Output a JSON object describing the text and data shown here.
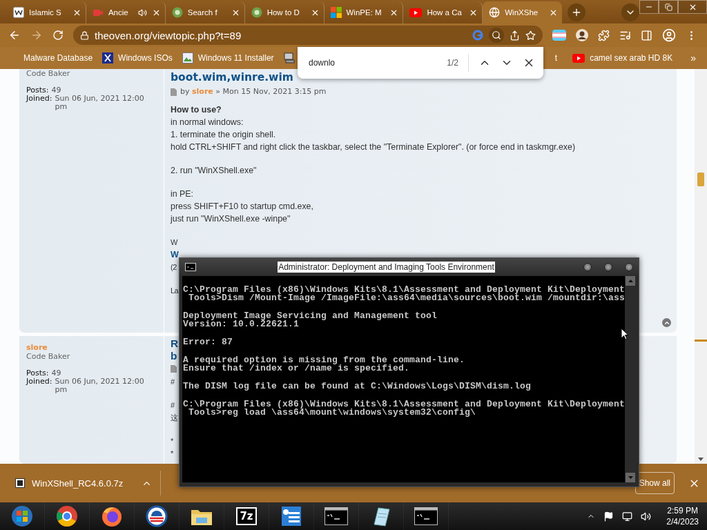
{
  "browser": {
    "tabs": [
      {
        "title": "Islamic S",
        "kind": "wiki",
        "selected": false,
        "audio": false
      },
      {
        "title": "Ancie",
        "kind": "video",
        "selected": false,
        "audio": true
      },
      {
        "title": "Search f",
        "kind": "site",
        "selected": false,
        "audio": false
      },
      {
        "title": "How to D",
        "kind": "site",
        "selected": false,
        "audio": false
      },
      {
        "title": "WinPE: M",
        "kind": "windows",
        "selected": false,
        "audio": false
      },
      {
        "title": "How a Ca",
        "kind": "youtube",
        "selected": false,
        "audio": false
      },
      {
        "title": "WinXShe",
        "kind": "globe",
        "selected": true,
        "audio": false
      }
    ],
    "address": "theoven.org/viewtopic.php?t=89",
    "bookmarks": [
      {
        "label": "Malware Database",
        "kind": "plain"
      },
      {
        "label": "Windows ISOs",
        "kind": "x"
      },
      {
        "label": "Windows 11 Installer",
        "kind": "image"
      },
      {
        "kind": "computer"
      }
    ],
    "bookmarks_right": [
      {
        "label": "t",
        "kind": "plain"
      },
      {
        "label": "camel sex arab HD 8K",
        "kind": "youtube"
      }
    ],
    "more_bookmarks": "»",
    "find_bar": {
      "query": "downlo",
      "count": "1/2"
    }
  },
  "posts": [
    {
      "rank": "Code Baker",
      "posts_label": "Posts:",
      "posts": "49",
      "joined_label": "Joined:",
      "joined": "Sun 06 Jun, 2021 12:00 pm",
      "title": "boot.wim,winre.wim",
      "byline": {
        "by": "by",
        "author": "slore",
        "date": "» Mon 15 Nov, 2021 3:15 pm"
      },
      "heading": "How to use?",
      "paragraphs": [
        [
          "in normal windows:",
          "1. terminate the origin shell.",
          "hold CTRL+SHIFT and right click the taskbar, select the \"Terminate Explorer\". (or force end in taskmgr.exe)"
        ],
        [
          "2. run \"WinXShell.exe\""
        ],
        [
          "in PE:",
          "press SHIFT+F10 to startup cmd.exe,",
          "just run \"WinXShell.exe -winpe\""
        ]
      ],
      "fragment_groups": [
        [
          {
            "text": "W",
            "kind": "text"
          },
          {
            "text": "W",
            "kind": "link"
          },
          {
            "text": "(2",
            "kind": "text"
          }
        ],
        [
          {
            "text": "La",
            "kind": "text"
          }
        ]
      ],
      "back_to_top": true
    },
    {
      "author": "slore",
      "rank": "Code Baker",
      "posts_label": "Posts:",
      "posts": "49",
      "joined_label": "Joined:",
      "joined": "Sun 06 Jun, 2021 12:00 pm",
      "fragment_groups": [
        [
          {
            "text": "R",
            "kind": "title"
          },
          {
            "text": "b",
            "kind": "title"
          },
          {
            "kind": "icon"
          },
          {
            "text": "#",
            "kind": "text"
          }
        ],
        [
          {
            "text": "#",
            "kind": "text"
          },
          {
            "text": "这",
            "kind": "text"
          }
        ],
        [
          {
            "text": "*",
            "kind": "text"
          },
          {
            "text": "*",
            "kind": "text"
          }
        ]
      ],
      "back_to_top": false
    }
  ],
  "console": {
    "title": "Administrator: Deployment and Imaging Tools Environment",
    "blocks": [
      [
        "C:\\Program Files (x86)\\Windows Kits\\8.1\\Assessment and Deployment Kit\\Deployment",
        " Tools>Dism /Mount-Image /ImageFile:\\ass64\\media\\sources\\boot.wim /mountdir:\\ass"
      ],
      [
        "Deployment Image Servicing and Management tool",
        "Version: 10.0.22621.1"
      ],
      [
        "Error: 87"
      ],
      [
        "A required option is missing from the command-line.",
        "Ensure that /index or /name is specified."
      ],
      [
        "The DISM log file can be found at C:\\Windows\\Logs\\DISM\\dism.log"
      ],
      [
        "C:\\Program Files (x86)\\Windows Kits\\8.1\\Assessment and Deployment Kit\\Deployment",
        " Tools>reg load \\ass64\\mount\\windows\\system32\\config\\"
      ]
    ]
  },
  "download_bar": {
    "file": "WinXShell_RC4.6.0.7z",
    "show_all": "Show all"
  },
  "taskbar": {
    "apps": [
      {
        "kind": "start"
      },
      {
        "kind": "chrome"
      },
      {
        "kind": "firefox"
      },
      {
        "kind": "campaign"
      },
      {
        "kind": "explorer"
      },
      {
        "kind": "archiver",
        "label": "7z"
      },
      {
        "kind": "control-panel"
      },
      {
        "kind": "console"
      },
      {
        "kind": "notepad"
      },
      {
        "kind": "console"
      }
    ],
    "time": "2:59 PM",
    "date": "2/4/2023"
  }
}
